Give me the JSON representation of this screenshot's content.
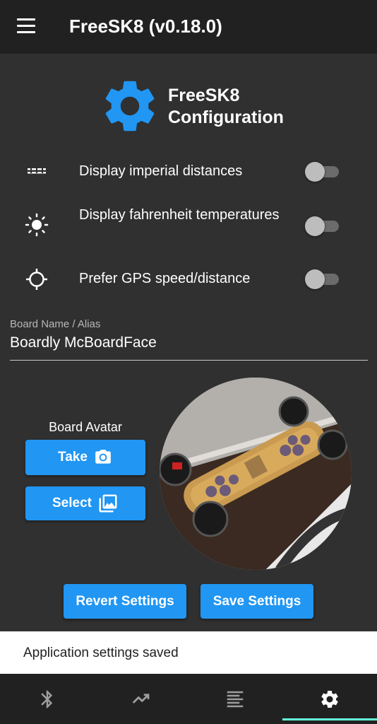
{
  "appbar": {
    "title": "FreeSK8 (v0.18.0)",
    "menu_icon": "menu-icon"
  },
  "header": {
    "icon": "gear-icon",
    "title": "FreeSK8 Configuration",
    "accent": "#2196f3"
  },
  "settings": [
    {
      "icon": "straighten-icon",
      "label": "Display imperial distances",
      "enabled": false
    },
    {
      "icon": "sun-icon",
      "label": "Display fahrenheit temperatures",
      "enabled": false
    },
    {
      "icon": "gps-crosshair-icon",
      "label": "Prefer GPS speed/distance",
      "enabled": false
    }
  ],
  "board_name": {
    "label": "Board Name / Alias",
    "value": "Boardly McBoardFace"
  },
  "avatar": {
    "label": "Board Avatar",
    "take_label": "Take",
    "take_icon": "camera-icon",
    "select_label": "Select",
    "select_icon": "photo-library-icon"
  },
  "actions": {
    "revert_label": "Revert Settings",
    "save_label": "Save Settings"
  },
  "snackbar": {
    "message": "Application settings saved"
  },
  "bottom_nav": {
    "items": [
      {
        "icon": "bluetooth-icon",
        "active": false
      },
      {
        "icon": "trending-icon",
        "active": false
      },
      {
        "icon": "list-icon",
        "active": false
      },
      {
        "icon": "settings-icon",
        "active": true
      }
    ],
    "indicator_color": "#64ffda"
  }
}
